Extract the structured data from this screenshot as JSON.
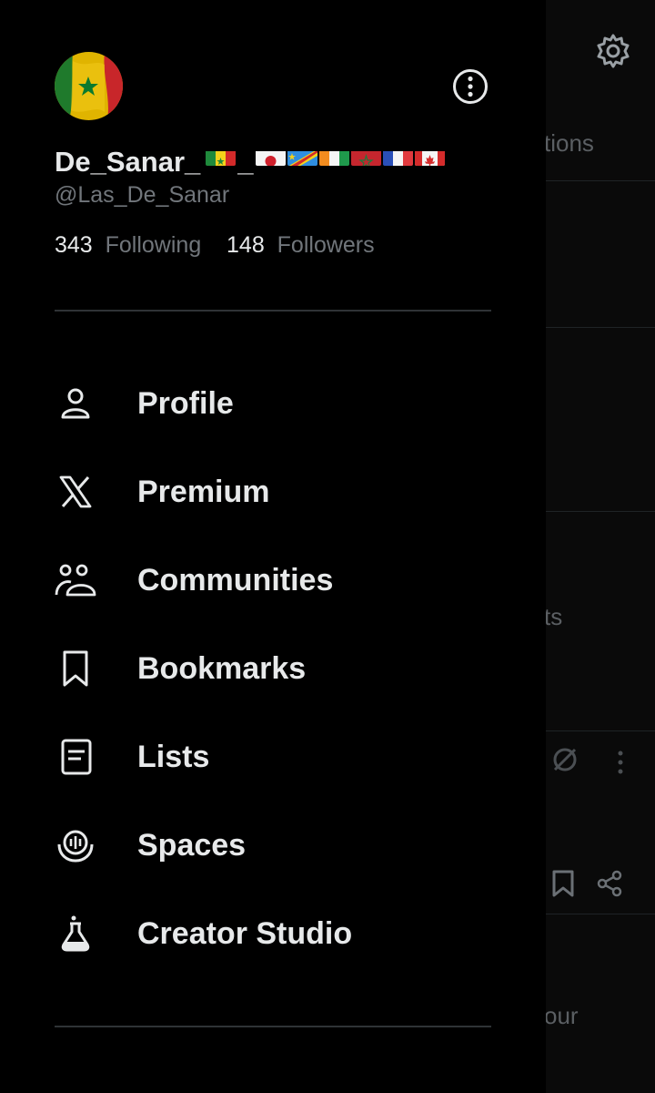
{
  "profile": {
    "display_name": "De_Sanar_",
    "display_name_sep": "_",
    "handle": "@Las_De_Sanar",
    "following_count": "343",
    "following_label": "Following",
    "followers_count": "148",
    "followers_label": "Followers",
    "flags": [
      "senegal",
      "japan",
      "dr-congo",
      "ivory-coast",
      "morocco",
      "france",
      "canada"
    ]
  },
  "menu": {
    "items": [
      {
        "label": "Profile",
        "icon": "person-icon"
      },
      {
        "label": "Premium",
        "icon": "x-logo-icon"
      },
      {
        "label": "Communities",
        "icon": "communities-icon"
      },
      {
        "label": "Bookmarks",
        "icon": "bookmark-icon"
      },
      {
        "label": "Lists",
        "icon": "list-icon"
      },
      {
        "label": "Spaces",
        "icon": "spaces-icon"
      },
      {
        "label": "Creator Studio",
        "icon": "flask-icon"
      }
    ]
  },
  "background": {
    "tab_fragment": "tions",
    "text_fragment_1": "ts",
    "text_fragment_2": "our"
  },
  "colors": {
    "background": "#000000",
    "text_primary": "#e7e9ea",
    "text_secondary": "#71767b",
    "divider": "#2f3336"
  }
}
